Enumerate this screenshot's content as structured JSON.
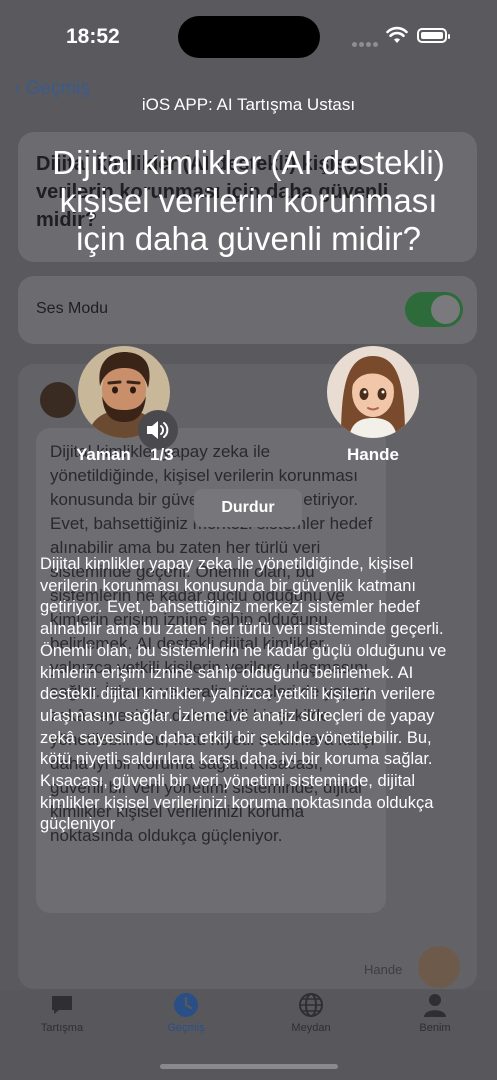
{
  "status_bar": {
    "time": "18:52"
  },
  "background": {
    "back_label": "Geçmiş",
    "topic_text": "Dijital kimlikler (AI destekli) kişisel verilerin korunması için daha güvenli midir?",
    "voice_mode_label": "Ses Modu",
    "message_text": "Dijital kimlikler yapay zeka ile yönetildiğinde, kişisel verilerin korunması konusunda bir güvenlik katmanı getiriyor. Evet, bahsettiğiniz merkezi sistemler hedef alınabilir ama bu zaten her türlü veri sisteminde geçerli. Önemli olan, bu sistemlerin ne kadar güçlü olduğunu ve kimlerin erişim iznine sahip olduğunu belirlemek. AI destekli dijital kimlikler, yalnızca yetkili kişilerin verilere ulaşmasını sağlar. İzleme ve analiz süreçleri de yapay zekâ sayesinde daha etkili bir şekilde yönetilebilir. Bu, kötü niyetli saldırılara karşı daha iyi bir koruma sağlar. Kısacası, güvenli bir veri yönetimi sisteminde, dijital kimlikler kişisel verilerinizi koruma noktasında oldukça güçleniyor.",
    "hande_label": "Hande"
  },
  "tabs": [
    {
      "label": "Tartışma",
      "icon": "chat-bubble-icon"
    },
    {
      "label": "Geçmiş",
      "icon": "clock-icon",
      "active": true
    },
    {
      "label": "Meydan",
      "icon": "globe-icon"
    },
    {
      "label": "Benim",
      "icon": "person-icon"
    }
  ],
  "overlay": {
    "app_title": "iOS APP: AI Tartışma Ustası",
    "topic": "Dijital kimlikler (AI destekli) kişisel verilerin korunması için daha güvenli midir?",
    "speaker_left": {
      "name": "Yaman",
      "turn": "1/3"
    },
    "speaker_right": {
      "name": "Hande"
    },
    "stop_label": "Durdur",
    "speech_text": "Dijital kimlikler yapay zeka ile yönetildiğinde, kişisel verilerin korunması konusunda bir güvenlik katmanı getiriyor. Evet, bahsettiğiniz merkezi sistemler hedef alınabilir ama bu zaten her türlü veri sisteminde geçerli. Önemli olan, bu sistemlerin ne kadar güçlü olduğunu ve kimlerin erişim iznine sahip olduğunu belirlemek. AI destekli dijital kimlikler, yalnızca yetkili kişilerin verilere ulaşmasını sağlar. İzleme ve analiz süreçleri de yapay zekâ sayesinde daha etkili bir şekilde yönetilebilir. Bu, kötü niyetli saldırılara karşı daha iyi bir koruma sağlar. Kısacası, güvenli bir veri yönetimi sisteminde, dijital kimlikler kişisel verilerinizi koruma noktasında oldukça güçleniyor"
  },
  "colors": {
    "accent": "#2a4f86",
    "toggle_on": "#2e6b3a"
  }
}
